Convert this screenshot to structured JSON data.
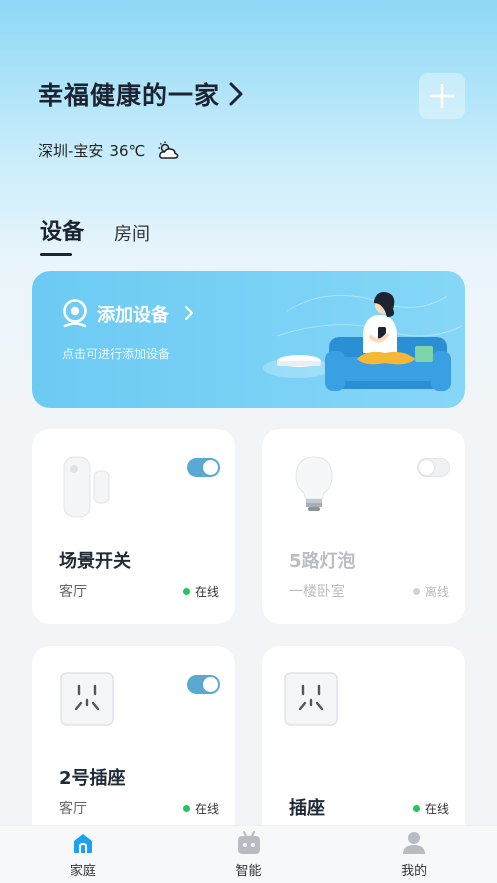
{
  "header": {
    "home_name": "幸福健康的一家",
    "location": "深圳-宝安",
    "temperature": "36℃",
    "weather_icon": "partly-cloudy-icon"
  },
  "tabs": [
    {
      "label": "设备",
      "active": true
    },
    {
      "label": "房间",
      "active": false
    }
  ],
  "banner": {
    "title": "添加设备",
    "subtitle": "点击可进行添加设备"
  },
  "devices": [
    {
      "name": "场景开关",
      "room": "客厅",
      "status": "在线",
      "on": true,
      "online": true,
      "icon": "door-sensor-icon"
    },
    {
      "name": "5路灯泡",
      "room": "一楼卧室",
      "status": "离线",
      "on": false,
      "online": false,
      "icon": "bulb-icon"
    },
    {
      "name": "2号插座",
      "room": "客厅",
      "status": "在线",
      "on": true,
      "online": true,
      "icon": "socket-icon"
    },
    {
      "name": "插座",
      "room": "",
      "status": "在线",
      "online": true,
      "icon": "socket-icon"
    }
  ],
  "tabbar": [
    {
      "label": "家庭",
      "active": true,
      "icon": "home-icon"
    },
    {
      "label": "智能",
      "active": false,
      "icon": "robot-icon"
    },
    {
      "label": "我的",
      "active": false,
      "icon": "user-icon"
    }
  ],
  "colors": {
    "accent": "#5aa9d3",
    "banner": "#74cff5",
    "online": "#22c55e",
    "offline": "#cfd3d8"
  }
}
